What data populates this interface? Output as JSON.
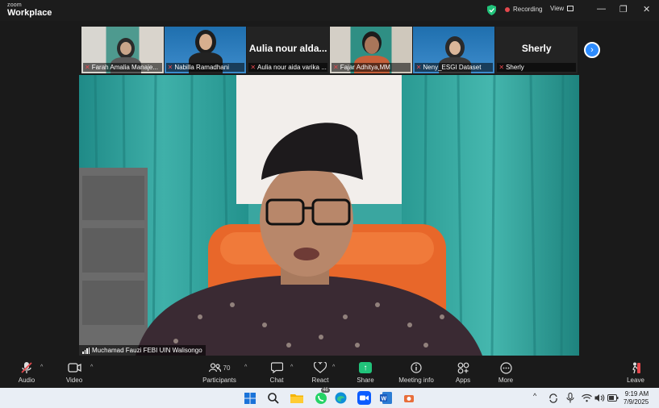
{
  "titlebar": {
    "brand_small": "zoom",
    "brand_big": "Workplace",
    "recording": "Recording",
    "view": "View",
    "minimize": "—",
    "restore": "❐",
    "close": "✕"
  },
  "gallery": [
    {
      "name": "Farah Amalia Manaje...",
      "muted": true,
      "big_name": ""
    },
    {
      "name": "Nabilla Ramadhani",
      "muted": true,
      "big_name": ""
    },
    {
      "name": "Aulia nour aida varika ...",
      "muted": true,
      "big_name": "Aulia nour alda..."
    },
    {
      "name": "Fajar Adhitya,MM",
      "muted": true,
      "big_name": ""
    },
    {
      "name": "Neny_ESGI Dataset",
      "muted": true,
      "big_name": ""
    },
    {
      "name": "Sherly",
      "muted": true,
      "big_name": "Sherly"
    }
  ],
  "gallery_next": "›",
  "main_video": {
    "speaker_label": "Muchamad Fauzi FEBI UIN Walisongo"
  },
  "toolbar": {
    "audio": "Audio",
    "video": "Video",
    "participants": "Participants",
    "participants_count": "70",
    "chat": "Chat",
    "react": "React",
    "share": "Share",
    "meeting_info": "Meeting info",
    "apps": "Apps",
    "more": "More",
    "leave": "Leave"
  },
  "taskbar": {
    "whatsapp_badge": "46",
    "time": "9:19 AM",
    "date": "7/9/2025"
  },
  "colors": {
    "accent": "#2d8cff",
    "recording": "#e5484d",
    "share": "#21c37a",
    "secure": "#21c37a"
  }
}
